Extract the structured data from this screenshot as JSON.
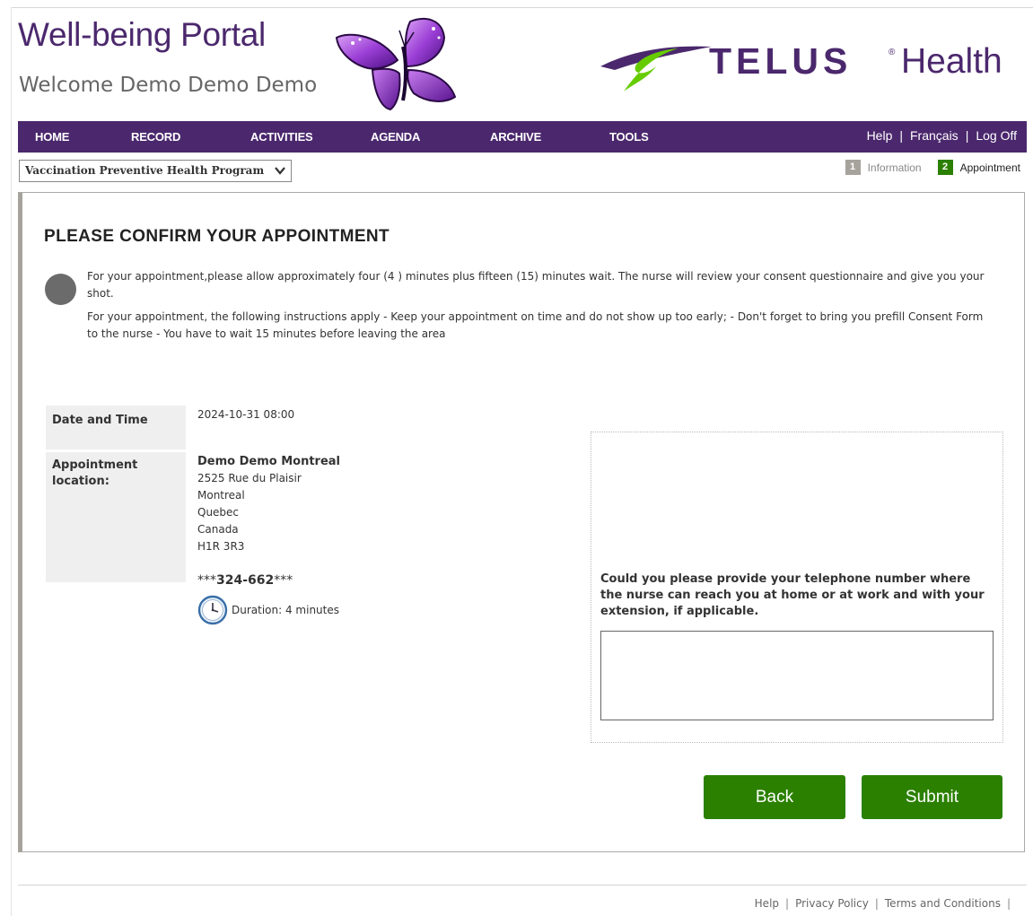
{
  "header": {
    "portal_title": "Well-being Portal",
    "welcome": "Welcome Demo Demo Demo",
    "brand_word": "TELUS",
    "brand_reg": "®",
    "brand_suffix": "Health",
    "brand_color": "#4b286d",
    "swoosh_color": "#66cc00"
  },
  "nav": {
    "items": [
      "HOME",
      "RECORD",
      "ACTIVITIES",
      "AGENDA",
      "ARCHIVE",
      "TOOLS"
    ],
    "help": "Help",
    "sep": "|",
    "lang": "Français",
    "logoff": "Log Off"
  },
  "program_select": {
    "value": "Vaccination Preventive Health Program",
    "icon": "chevron-down-icon"
  },
  "steps": [
    {
      "number": "1",
      "label": "Information",
      "state": "inactive"
    },
    {
      "number": "2",
      "label": "Appointment",
      "state": "active"
    }
  ],
  "panel": {
    "title": "PLEASE CONFIRM YOUR APPOINTMENT",
    "info_icon": "info-dot-icon",
    "info_p1": "For your appointment,please allow approximately four (4 ) minutes plus fifteen (15) minutes wait. The nurse will review your consent questionnaire and give you your shot.",
    "info_p2": "For your appointment, the following instructions apply - Keep your appointment on time and do not show up too early; - Don't forget to bring you prefill Consent Form to the nurse - You have to wait 15 minutes before leaving the area",
    "date_label": "Date and Time",
    "date_value": "2024-10-31 08:00",
    "location_label": "Appointment location:",
    "location": {
      "name": "Demo Demo Montreal",
      "lines": [
        "2525 Rue du Plaisir",
        "Montreal",
        "Quebec",
        "Canada",
        "H1R 3R3"
      ]
    },
    "phone_prefix": "***",
    "phone_core": "324-662",
    "phone_suffix": "***",
    "duration_icon": "clock-icon",
    "duration": "Duration: 4 minutes",
    "phone_question": "Could you please provide your telephone number where the nurse can reach you at home or at work and with your extension, if applicable.",
    "phone_input_value": "",
    "back_label": "Back",
    "submit_label": "Submit",
    "button_color": "#2b8000"
  },
  "footer": {
    "links": [
      "Help",
      "Privacy Policy",
      "Terms and Conditions"
    ],
    "sep": "|"
  }
}
